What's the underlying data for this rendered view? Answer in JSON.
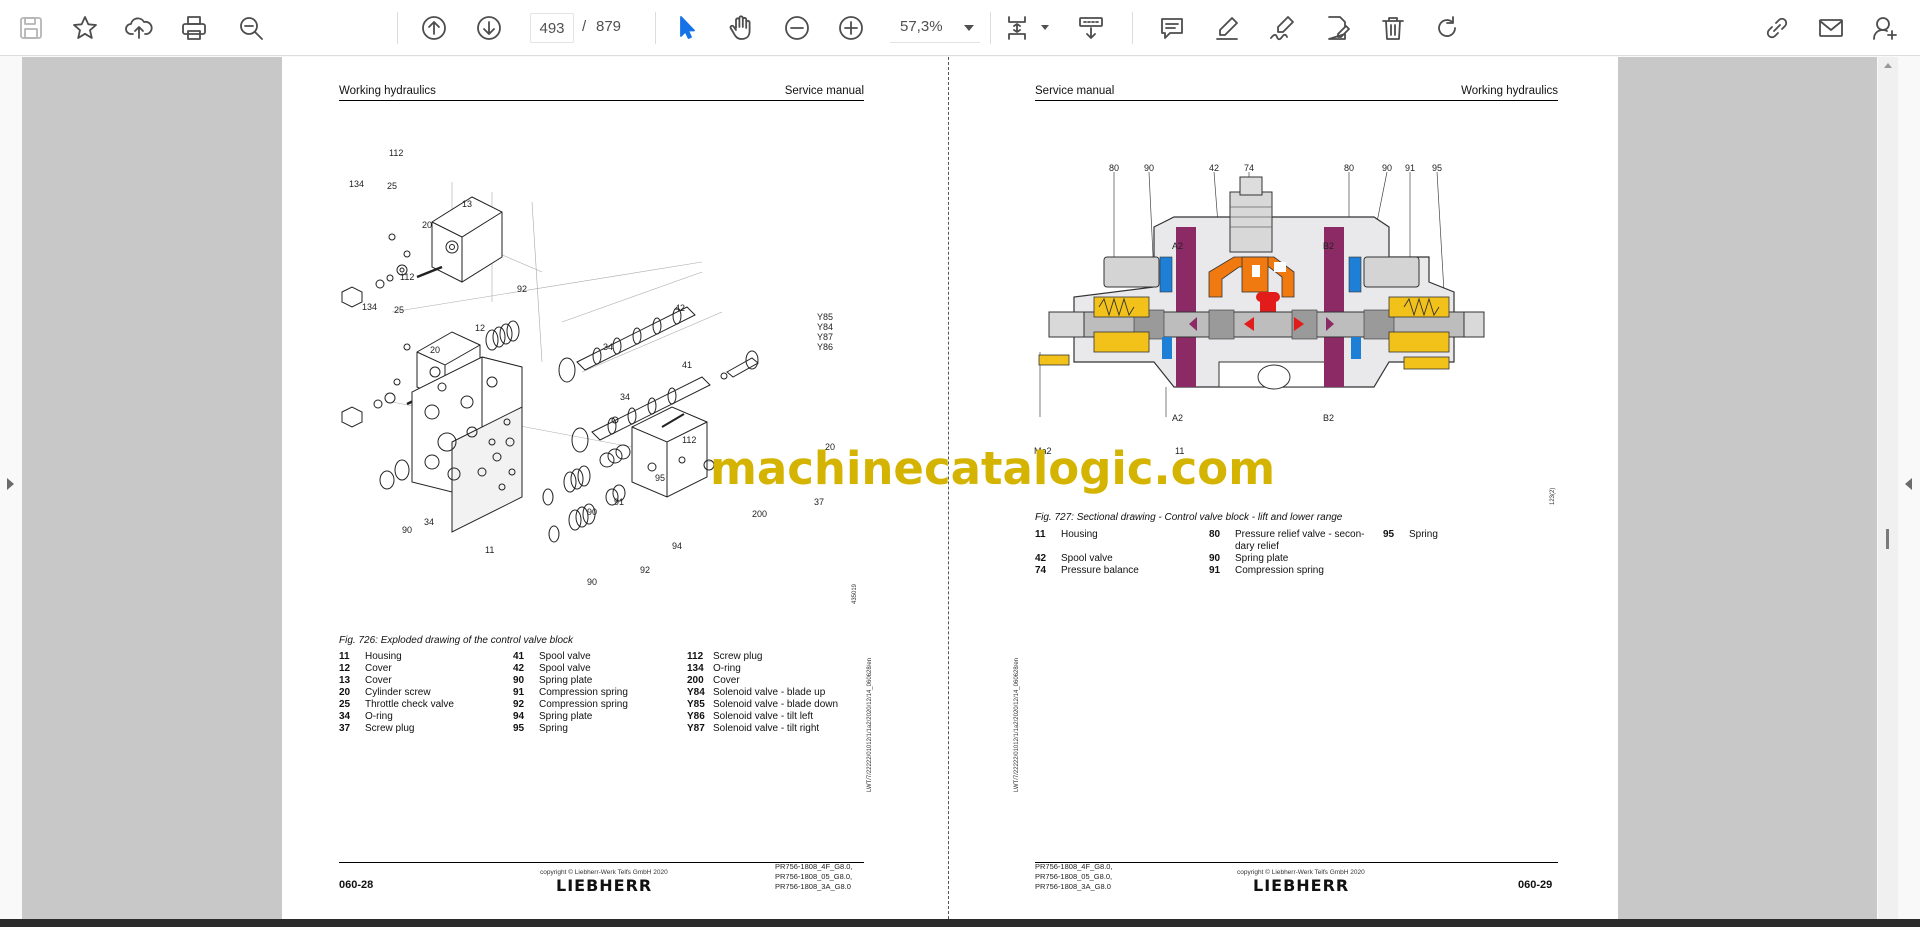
{
  "toolbar": {
    "page_current": "493",
    "page_separator": "/",
    "page_total": "879",
    "zoom": "57,3%",
    "icons": [
      "save-icon",
      "bookmark-star-icon",
      "upload-cloud-icon",
      "print-icon",
      "zoom-search-icon",
      "page-up-icon",
      "page-down-icon",
      "select-cursor-icon",
      "hand-tool-icon",
      "zoom-out-icon",
      "zoom-in-icon",
      "page-fit-icon",
      "scroll-mode-icon",
      "comment-icon",
      "highlight-pen-icon",
      "draw-signature-icon",
      "edit-pdf-icon",
      "delete-icon",
      "rotate-icon",
      "share-link-icon",
      "email-icon",
      "add-user-icon"
    ],
    "accent_color": "#1473e6"
  },
  "left_page": {
    "header_left": "Working hydraulics",
    "header_right": "Service manual",
    "figure_id": "435019",
    "caption": "Fig. 726: Exploded drawing of the control valve block",
    "callouts": [
      "112",
      "134",
      "25",
      "13",
      "20",
      "112",
      "92",
      "25",
      "134",
      "12",
      "20",
      "42",
      "Y85",
      "Y84",
      "Y87",
      "Y86",
      "34",
      "41",
      "34",
      "112",
      "20",
      "95",
      "91",
      "90",
      "37",
      "200",
      "94",
      "92",
      "90",
      "11",
      "90",
      "34"
    ],
    "legend": [
      [
        {
          "num": "11",
          "text": "Housing"
        },
        {
          "num": "41",
          "text": "Spool valve"
        },
        {
          "num": "112",
          "text": "Screw plug"
        }
      ],
      [
        {
          "num": "12",
          "text": "Cover"
        },
        {
          "num": "42",
          "text": "Spool valve"
        },
        {
          "num": "134",
          "text": "O-ring"
        }
      ],
      [
        {
          "num": "13",
          "text": "Cover"
        },
        {
          "num": "90",
          "text": "Spring plate"
        },
        {
          "num": "200",
          "text": "Cover"
        }
      ],
      [
        {
          "num": "20",
          "text": "Cylinder screw"
        },
        {
          "num": "91",
          "text": "Compression spring"
        },
        {
          "num": "Y84",
          "text": "Solenoid valve - blade up"
        }
      ],
      [
        {
          "num": "25",
          "text": "Throttle check valve"
        },
        {
          "num": "92",
          "text": "Compression spring"
        },
        {
          "num": "Y85",
          "text": "Solenoid valve - blade down"
        }
      ],
      [
        {
          "num": "34",
          "text": "O-ring"
        },
        {
          "num": "94",
          "text": "Spring plate"
        },
        {
          "num": "Y86",
          "text": "Solenoid valve - tilt left"
        }
      ],
      [
        {
          "num": "37",
          "text": "Screw plug"
        },
        {
          "num": "95",
          "text": "Spring"
        },
        {
          "num": "Y87",
          "text": "Solenoid valve - tilt right"
        }
      ]
    ],
    "side_code": "LWT/7/22222/01012/1/1a2/2020/12/14_060628/en",
    "footer_pagenum": "060-28",
    "footer_copyright": "copyright © Liebherr-Werk Telfs GmbH 2020",
    "footer_brand": "LIEBHERR",
    "footer_codes": [
      "PR756-1808_4F_G8.0,",
      "PR756-1808_05_G8.0,",
      "PR756-1808_3A_G8.0"
    ]
  },
  "right_page": {
    "header_left": "Service manual",
    "header_right": "Working hydraulics",
    "figure_id": "123(2)",
    "callouts_top": [
      "80",
      "90",
      "42",
      "74",
      "80",
      "90",
      "91",
      "95"
    ],
    "port_labels": [
      "A2",
      "B2",
      "A2",
      "B2",
      "Ma2",
      "11"
    ],
    "caption": "Fig. 727: Sectional drawing - Control valve block - lift and lower range",
    "legend": [
      [
        {
          "num": "11",
          "text": "Housing",
          "text2": ""
        },
        {
          "num": "80",
          "text": "Pressure relief valve - secon-",
          "text2": "dary relief"
        },
        {
          "num": "95",
          "text": "Spring",
          "text2": ""
        }
      ],
      [
        {
          "num": "42",
          "text": "Spool valve",
          "text2": ""
        },
        {
          "num": "90",
          "text": "Spring plate",
          "text2": ""
        }
      ],
      [
        {
          "num": "74",
          "text": "Pressure balance",
          "text2": ""
        },
        {
          "num": "91",
          "text": "Compression spring",
          "text2": ""
        }
      ]
    ],
    "side_code": "LWT/7/22222/01012/1/1a2/2020/12/14_060628/en",
    "footer_pagenum": "060-29",
    "footer_copyright": "copyright © Liebherr-Werk Telfs GmbH 2020",
    "footer_brand": "LIEBHERR",
    "footer_codes": [
      "PR756-1808_4F_G8.0,",
      "PR756-1808_05_G8.0,",
      "PR756-1808_3A_G8.0"
    ]
  },
  "watermark": "machinecatalogic.com",
  "colors": {
    "magenta_channel": "#8b2a64",
    "orange_pressure": "#f07a10",
    "yellow_pressure": "#f3c21a",
    "blue_tank": "#1e7fd6",
    "red_pressure": "#e21b1b",
    "watermark": "#d4b400"
  }
}
